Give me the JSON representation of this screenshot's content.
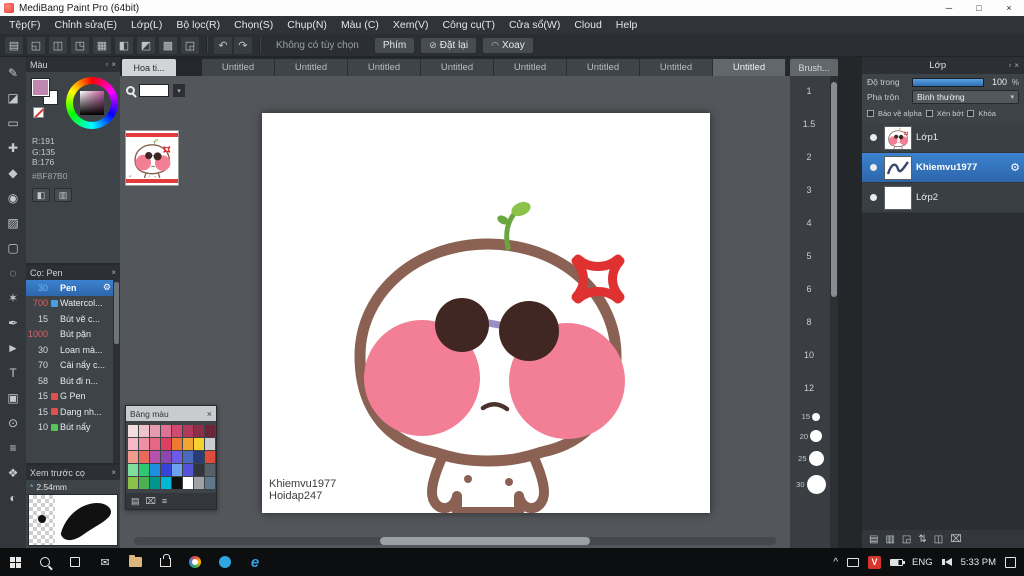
{
  "window": {
    "title": "MediBang Paint Pro (64bit)"
  },
  "window_controls": {
    "minimize": "─",
    "maximize": "□",
    "close": "×"
  },
  "menu_bar": {
    "items": [
      "Tệp(F)",
      "Chỉnh sửa(E)",
      "Lớp(L)",
      "Bộ lọc(R)",
      "Chọn(S)",
      "Chụp(N)",
      "Màu (C)",
      "Xem(V)",
      "Công cụ(T)",
      "Cửa sổ(W)",
      "Cloud",
      "Help"
    ]
  },
  "toolbar": {
    "icons": [
      {
        "name": "new-canvas-icon",
        "glyph": "▤"
      },
      {
        "name": "open-icon",
        "glyph": "◱"
      },
      {
        "name": "save-icon",
        "glyph": "◫"
      },
      {
        "name": "export-icon",
        "glyph": "◳"
      },
      {
        "name": "grid-icon",
        "glyph": "▦"
      },
      {
        "name": "snap-icon",
        "glyph": "◧"
      },
      {
        "name": "mirror-icon",
        "glyph": "◩"
      },
      {
        "name": "material-icon",
        "glyph": "▩"
      },
      {
        "name": "settings-icon",
        "glyph": "◲"
      }
    ],
    "undo_icon": "↶",
    "redo_icon": "↷",
    "options_label": "Không có tùy chọn",
    "keys_button": "Phím",
    "reset_button": "Đặt lại",
    "rotate_button": "Xoay"
  },
  "tabs": {
    "material_tab": "Hoa ti...",
    "brush_tab": "Brush...",
    "documents": [
      {
        "label": "Untitled"
      },
      {
        "label": "Untitled"
      },
      {
        "label": "Untitled"
      },
      {
        "label": "Untitled"
      },
      {
        "label": "Untitled"
      },
      {
        "label": "Untitled"
      },
      {
        "label": "Untitled"
      },
      {
        "label": "Untitled",
        "selected": true
      }
    ]
  },
  "materials": {
    "search_value": ""
  },
  "tools": [
    {
      "name": "brush-tool",
      "glyph": "✎"
    },
    {
      "name": "eraser-tool",
      "glyph": "◪"
    },
    {
      "name": "marquee-tool",
      "glyph": "▭"
    },
    {
      "name": "move-tool",
      "glyph": "✚"
    },
    {
      "name": "fill-tool",
      "glyph": "◆"
    },
    {
      "name": "bucket-tool",
      "glyph": "◉"
    },
    {
      "name": "gradient-tool",
      "glyph": "▨"
    },
    {
      "name": "select-tool",
      "glyph": "▢"
    },
    {
      "name": "lasso-tool",
      "glyph": "◌"
    },
    {
      "name": "magic-wand-tool",
      "glyph": "✶"
    },
    {
      "name": "pen-tool",
      "glyph": "✒"
    },
    {
      "name": "operation-tool",
      "glyph": "►"
    },
    {
      "name": "text-tool",
      "glyph": "T"
    },
    {
      "name": "frame-tool",
      "glyph": "▣"
    },
    {
      "name": "eyedropper-tool",
      "glyph": "⊙"
    },
    {
      "name": "panel-tool",
      "glyph": "≡"
    },
    {
      "name": "divide-tool",
      "glyph": "❖"
    },
    {
      "name": "hand-tool",
      "glyph": "◐"
    }
  ],
  "color_panel": {
    "title": "Màu",
    "r_label": "R:191",
    "g_label": "G:135",
    "b_label": "B:176",
    "hex": "#BF87B0",
    "foreground_color": "#bf87b0"
  },
  "brush_panel": {
    "title": "Cọ: Pen",
    "brushes": [
      {
        "size": "30",
        "size_color": "#6db9f2",
        "name": "Pen",
        "selected": true,
        "gear": "⚙"
      },
      {
        "size": "700",
        "size_color": "#e06060",
        "chip": "#4a9de0",
        "name": "Watercol..."
      },
      {
        "size": "15",
        "size_color": "#d9dde1",
        "name": "Bút vẽ c..."
      },
      {
        "size": "1000",
        "size_color": "#e06060",
        "name": "Bút pặn"
      },
      {
        "size": "30",
        "size_color": "#d9dde1",
        "name": "Loan mà..."
      },
      {
        "size": "70",
        "size_color": "#d9dde1",
        "name": "Cải nẩy c..."
      },
      {
        "size": "58",
        "size_color": "#d9dde1",
        "name": "Bút đi n..."
      },
      {
        "size": "15",
        "size_color": "#d9dde1",
        "chip": "#e05050",
        "name": "G Pen"
      },
      {
        "size": "15",
        "size_color": "#d9dde1",
        "chip": "#e05050",
        "name": "Dạng nh..."
      },
      {
        "size": "10",
        "size_color": "#d9dde1",
        "chip": "#57c457",
        "name": "Bút nẩy"
      }
    ]
  },
  "preview_panel": {
    "title": "Xem trước cọ",
    "modified_mark": "*",
    "size_label": "2.54mm"
  },
  "palette_panel": {
    "title": "Bảng màu",
    "colors": [
      "#f2dede",
      "#eec3cd",
      "#e89bb0",
      "#df7293",
      "#d14a72",
      "#b03a5c",
      "#8c2e48",
      "#6b2438",
      "#f5b8c4",
      "#ef8fa3",
      "#e76684",
      "#dd3f62",
      "#ed7a32",
      "#f2a632",
      "#f5d232",
      "#c9ccd0",
      "#f09c8c",
      "#e86a58",
      "#b452ae",
      "#8d46ad",
      "#6b5ce6",
      "#4a6abd",
      "#2a3c75",
      "#e04c3c",
      "#7dde9e",
      "#2ec871",
      "#1e8fe0",
      "#3744d8",
      "#6ea1f0",
      "#5352d8",
      "#30363c",
      "#575f68",
      "#8bc34a",
      "#4caf50",
      "#00968c",
      "#00b8d4",
      "#101010",
      "#ffffff",
      "#9ea3a8",
      "#60788c"
    ]
  },
  "size_panel": {
    "ticks": [
      "1",
      "1.5",
      "2",
      "3",
      "4",
      "5",
      "6",
      "8",
      "10",
      "12"
    ],
    "dot_labels": [
      "15",
      "20",
      "25",
      "30"
    ]
  },
  "layers_panel": {
    "title": "Lớp",
    "opacity_label": "Độ trong",
    "opacity_value": "100",
    "opacity_unit": "%",
    "blend_label": "Pha trộn",
    "blend_value": "Bình thường",
    "alpha_label": "Bảo vệ alpha",
    "clip_label": "Xén bớt",
    "lock_label": "Khóa",
    "layers": [
      {
        "name": "Lớp1"
      },
      {
        "name": "Khiemvu1977",
        "selected": true
      },
      {
        "name": "Lớp2"
      }
    ],
    "footer_icons": [
      {
        "name": "add-layer-icon",
        "glyph": "▤"
      },
      {
        "name": "layer-folder-icon",
        "glyph": "▥"
      },
      {
        "name": "import-layer-icon",
        "glyph": "◲"
      },
      {
        "name": "move-layer-icon",
        "glyph": "⇅"
      },
      {
        "name": "merge-layer-icon",
        "glyph": "◫"
      },
      {
        "name": "delete-layer-icon",
        "glyph": "⌧"
      }
    ]
  },
  "canvas": {
    "signature_line1": "Khiemvu1977",
    "signature_line2": "Hoidap247"
  },
  "artwork_colors": {
    "outline": "#8a6152",
    "cheek": "#f27f95",
    "glasses": "#412722",
    "bridge": "#9b8ec4",
    "sprout": "#6aa63e",
    "leaf": "#8bc34a",
    "anger": "#e03131"
  },
  "icons": {
    "float": "▫",
    "close": "×",
    "gear": "⚙",
    "dropdown": "▾",
    "palette_new": "▤",
    "palette_delete": "⌧",
    "palette_menu": "≡",
    "picker": "◧",
    "palette_sw": "▥",
    "search_btn": "▾",
    "reset": "⊘",
    "rotate": "◠",
    "mail": "✉",
    "edge": "e",
    "tray_chevron": "^",
    "unikey": "V"
  },
  "taskbar": {
    "language": "ENG",
    "time": "5:33 PM"
  }
}
